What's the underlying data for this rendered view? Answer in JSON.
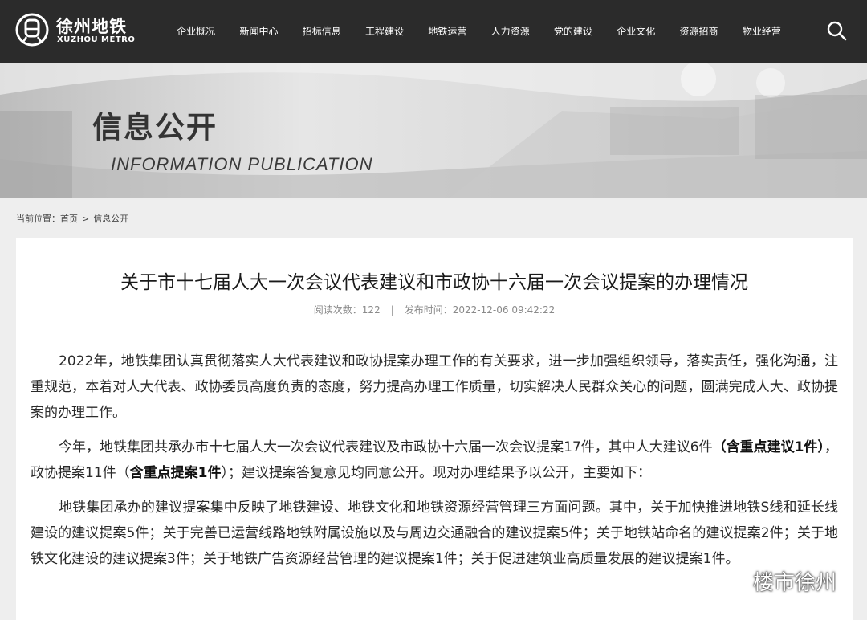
{
  "header": {
    "logo_cn": "徐州地铁",
    "logo_en": "XUZHOU METRO",
    "nav": [
      "企业概况",
      "新闻中心",
      "招标信息",
      "工程建设",
      "地铁运营",
      "人力资源",
      "党的建设",
      "企业文化",
      "资源招商",
      "物业经营"
    ],
    "search_icon": "search-icon"
  },
  "banner": {
    "title": "信息公开",
    "subtitle": "INFORMATION  PUBLICATION"
  },
  "breadcrumb": {
    "label": "当前位置：",
    "home": "首页",
    "separator": ">",
    "current": "信息公开"
  },
  "article": {
    "title": "关于市十七届人大一次会议代表建议和市政协十六届一次会议提案的办理情况",
    "views_label": "阅读次数：",
    "views": "122",
    "divider": "|",
    "date_label": "发布时间：",
    "date": "2022-12-06 09:42:22",
    "p1": "2022年，地铁集团认真贯彻落实人大代表建议和政协提案办理工作的有关要求，进一步加强组织领导，落实责任，强化沟通，注重规范，本着对人大代表、政协委员高度负责的态度，努力提高办理工作质量，切实解决人民群众关心的问题，圆满完成人大、政协提案的办理工作。",
    "p2_a": "今年，地铁集团共承办市十七届人大一次会议代表建议及市政协十六届一次会议提案17件，其中人大建议6件",
    "p2_b": "（含重点建议1件）",
    "p2_c": "，政协提案11件（",
    "p2_d": "含重点提案1件",
    "p2_e": "）；建议提案答复意见均同意公开。现对办理结果予以公开，主要如下：",
    "p3": "地铁集团承办的建议提案集中反映了地铁建设、地铁文化和地铁资源经营管理三方面问题。其中，关于加快推进地铁S线和延长线建设的建议提案5件；关于完善已运营线路地铁附属设施以及与周边交通融合的建议提案5件；关于地铁站命名的建议提案2件；关于地铁文化建设的建议提案3件；关于地铁广告资源经营管理的建议提案1件；关于促进建筑业高质量发展的建议提案1件。"
  },
  "watermark": {
    "text": "楼市徐州",
    "icon": "wechat-icon"
  }
}
